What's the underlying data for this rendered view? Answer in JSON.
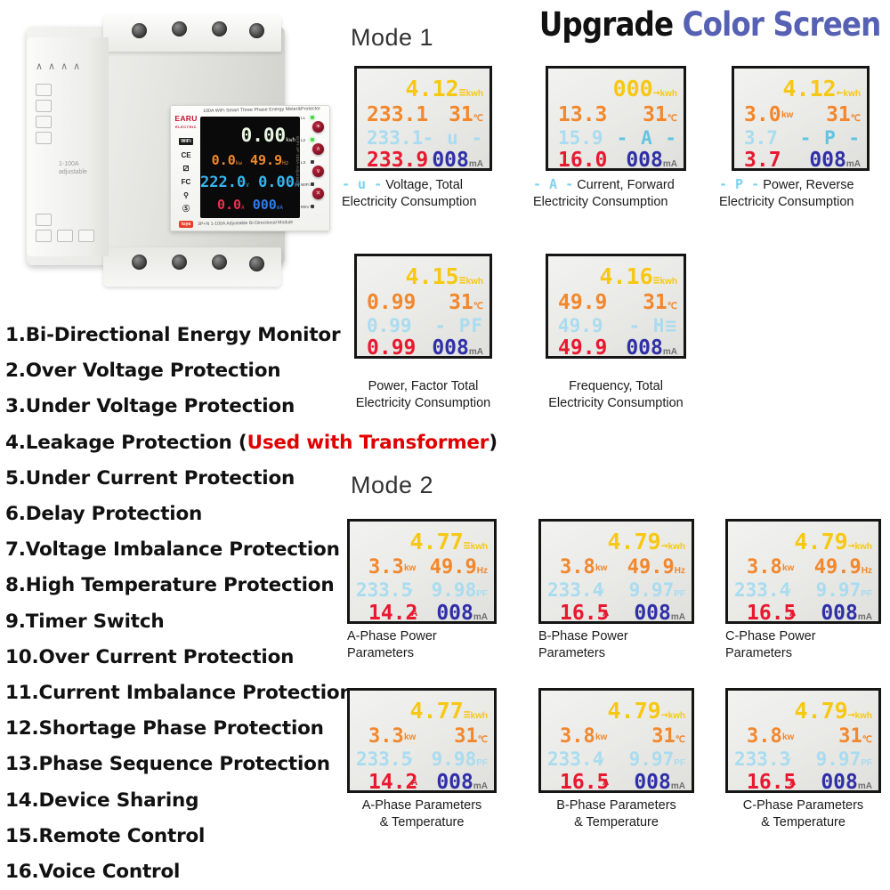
{
  "headline": {
    "part1": "Upgrade",
    "part2": "Color Screen"
  },
  "modes": {
    "mode1": "Mode 1",
    "mode2": "Mode 2"
  },
  "device": {
    "top_label": "100A WiFi Smart Three Phase Energy Meter&Protector",
    "bottom_label": "3P+N 1-100A Adjustable   Bi-Directional Module",
    "side_text": "1-100A adjustable",
    "vertical_text": "WIFI-3P-100A-Adjustable",
    "logo": "EARU",
    "logo_sub": "ELECTRIC",
    "badges": {
      "wifi": "WiFi",
      "ce": "CE",
      "rohs": "RoHS",
      "fc": "FC",
      "key": "Key",
      "power": "Power",
      "tuya": "tuya"
    },
    "lcd": {
      "energy": "0.00",
      "energy_unit": "kwh",
      "power": "0.0",
      "power_unit": "kw",
      "freq": "49.9",
      "freq_unit": "Hz",
      "voltage": "222.0",
      "voltage_unit": "V",
      "pf": "0.00",
      "pf_unit": "PF",
      "current": "0.0",
      "current_unit": "A",
      "leak": "000",
      "leak_unit": "mA"
    },
    "controls": [
      {
        "label": "L1",
        "led": "on",
        "button": "☀"
      },
      {
        "label": "L2",
        "led": "on",
        "button": "∧"
      },
      {
        "label": "L3",
        "led": "off",
        "button": "∨"
      },
      {
        "label": "WIFI",
        "led": "off",
        "button": "✕"
      },
      {
        "label": "REV",
        "led": "off",
        "button": ""
      }
    ]
  },
  "features": [
    {
      "text": "1.Bi-Directional Energy Monitor"
    },
    {
      "text": "2.Over Voltage Protection"
    },
    {
      "text": "3.Under Voltage Protection"
    },
    {
      "text": "4.Leakage Protection (",
      "note": "Used with Transformer",
      "tail": ")"
    },
    {
      "text": "5.Under Current Protection"
    },
    {
      "text": "6.Delay Protection"
    },
    {
      "text": "7.Voltage Imbalance Protection"
    },
    {
      "text": "8.High Temperature Protection"
    },
    {
      "text": "9.Timer Switch"
    },
    {
      "text": "10.Over Current Protection"
    },
    {
      "text": "11.Current Imbalance Protection"
    },
    {
      "text": "12.Shortage Phase Protection"
    },
    {
      "text": "13.Phase Sequence Protection"
    },
    {
      "text": "14.Device Sharing"
    },
    {
      "text": "15.Remote Control"
    },
    {
      "text": "16.Voice Control"
    }
  ],
  "mode1_panels": [
    {
      "id": "voltage-total",
      "l1_value": "4.12",
      "l1_mark": "≡",
      "l1_unit": "kwh",
      "l2_left": "233.1",
      "l2_left_unit": "",
      "l2_right": "31",
      "l2_right_unit": "℃",
      "l3_left": "233.1",
      "l3_left_unit": "v",
      "l3_sym": "- u -",
      "l4_left": "233.9",
      "l4_left_unit": "",
      "l4_right": "008",
      "l4_right_unit": "mA",
      "caption_sym": "- u -",
      "caption_l1": "Voltage, Total",
      "caption_l2": "Electricity Consumption"
    },
    {
      "id": "current-forward",
      "l1_value": "000",
      "l1_mark": "→",
      "l1_unit": "kwh",
      "l2_left": "13.3",
      "l2_left_unit": "",
      "l2_right": "31",
      "l2_right_unit": "℃",
      "l3_left": "15.9",
      "l3_left_unit": "v",
      "l3_sym": "- A -",
      "l4_left": "16.0",
      "l4_left_unit": "A",
      "l4_right": "008",
      "l4_right_unit": "mA",
      "caption_sym": "- A -",
      "caption_l1": "Current, Forward",
      "caption_l2": "Electricity Consumption"
    },
    {
      "id": "power-reverse",
      "l1_value": "4.12",
      "l1_mark": "←",
      "l1_unit": "kwh",
      "l2_left": "3.0",
      "l2_left_unit": "kw",
      "l2_right": "31",
      "l2_right_unit": "℃",
      "l3_left": "3.7",
      "l3_left_unit": "",
      "l3_sym": "- P -",
      "l4_left": "3.7",
      "l4_left_unit": "",
      "l4_right": "008",
      "l4_right_unit": "mA",
      "caption_sym": "- P -",
      "caption_l1": "Power, Reverse",
      "caption_l2": "Electricity Consumption"
    },
    {
      "id": "power-factor-total",
      "l1_value": "4.15",
      "l1_mark": "≡",
      "l1_unit": "kwh",
      "l2_left": "0.99",
      "l2_left_unit": "",
      "l2_right": "31",
      "l2_right_unit": "℃",
      "l3_left": "0.99",
      "l3_left_unit": "",
      "l3_sym": "- PF",
      "l4_left": "0.99",
      "l4_left_unit": "",
      "l4_right": "008",
      "l4_right_unit": "mA",
      "caption_sym": "",
      "caption_l1": "Power, Factor Total",
      "caption_l2": "Electricity Consumption"
    },
    {
      "id": "frequency-total",
      "l1_value": "4.16",
      "l1_mark": "≡",
      "l1_unit": "kwh",
      "l2_left": "49.9",
      "l2_left_unit": "",
      "l2_right": "31",
      "l2_right_unit": "℃",
      "l3_left": "49.9",
      "l3_left_unit": "",
      "l3_sym": "- H≡",
      "l4_left": "49.9",
      "l4_left_unit": "",
      "l4_right": "008",
      "l4_right_unit": "mA",
      "caption_sym": "",
      "caption_l1": "Frequency, Total",
      "caption_l2": "Electricity Consumption"
    }
  ],
  "mode2_panels": [
    {
      "id": "a-phase-power",
      "l1_value": "4.77",
      "l1_mark": "≡",
      "l1_unit": "kwh",
      "l2_left": "3.3",
      "l2_left_unit": "kw",
      "l2_right": "49.9",
      "l2_right_unit": "Hz",
      "l3_left": "233.5",
      "l3_left_unit": "v",
      "l3_right": "9.98",
      "l3_right_unit": "PF",
      "l4_left": "14.2",
      "l4_left_unit": "A",
      "l4_right": "008",
      "l4_right_unit": "mA",
      "caption_l1": "A-Phase Power Parameters",
      "caption_l2": ""
    },
    {
      "id": "b-phase-power",
      "l1_value": "4.79",
      "l1_mark": "→",
      "l1_unit": "kwh",
      "l2_left": "3.8",
      "l2_left_unit": "kw",
      "l2_right": "49.9",
      "l2_right_unit": "Hz",
      "l3_left": "233.4",
      "l3_left_unit": "v",
      "l3_right": "9.97",
      "l3_right_unit": "PF",
      "l4_left": "16.5",
      "l4_left_unit": "A",
      "l4_right": "008",
      "l4_right_unit": "mA",
      "caption_l1": "B-Phase Power Parameters",
      "caption_l2": ""
    },
    {
      "id": "c-phase-power",
      "l1_value": "4.79",
      "l1_mark": "→",
      "l1_unit": "kwh",
      "l2_left": "3.8",
      "l2_left_unit": "kw",
      "l2_right": "49.9",
      "l2_right_unit": "Hz",
      "l3_left": "233.4",
      "l3_left_unit": "v",
      "l3_right": "9.97",
      "l3_right_unit": "PF",
      "l4_left": "16.5",
      "l4_left_unit": "A",
      "l4_right": "008",
      "l4_right_unit": "mA",
      "caption_l1": "C-Phase Power Parameters",
      "caption_l2": ""
    },
    {
      "id": "a-phase-temp",
      "l1_value": "4.77",
      "l1_mark": "≡",
      "l1_unit": "kwh",
      "l2_left": "3.3",
      "l2_left_unit": "kw",
      "l2_right": "31",
      "l2_right_unit": "℃",
      "l3_left": "233.5",
      "l3_left_unit": "v",
      "l3_right": "9.98",
      "l3_right_unit": "PF",
      "l4_left": "14.2",
      "l4_left_unit": "A",
      "l4_right": "008",
      "l4_right_unit": "mA",
      "caption_l1": "A-Phase Parameters",
      "caption_l2": "& Temperature"
    },
    {
      "id": "b-phase-temp",
      "l1_value": "4.79",
      "l1_mark": "→",
      "l1_unit": "kwh",
      "l2_left": "3.8",
      "l2_left_unit": "kw",
      "l2_right": "31",
      "l2_right_unit": "℃",
      "l3_left": "233.4",
      "l3_left_unit": "v",
      "l3_right": "9.97",
      "l3_right_unit": "PF",
      "l4_left": "16.5",
      "l4_left_unit": "A",
      "l4_right": "008",
      "l4_right_unit": "mA",
      "caption_l1": "B-Phase Parameters",
      "caption_l2": "&  Temperature"
    },
    {
      "id": "c-phase-temp",
      "l1_value": "4.79",
      "l1_mark": "→",
      "l1_unit": "kwh",
      "l2_left": "3.8",
      "l2_left_unit": "kw",
      "l2_right": "31",
      "l2_right_unit": "℃",
      "l3_left": "233.3",
      "l3_left_unit": "v",
      "l3_right": "9.97",
      "l3_right_unit": "PF",
      "l4_left": "16.5",
      "l4_left_unit": "A",
      "l4_right": "008",
      "l4_right_unit": "mA",
      "caption_l1": "C-Phase Parameters",
      "caption_l2": "&  Temperature"
    }
  ],
  "colors": {
    "accent_blue": "#5661b3",
    "note_red": "#e00000",
    "lcd_yellow": "#f7c813",
    "lcd_orange": "#f2872c",
    "lcd_cyan": "#a9dcf0",
    "lcd_red": "#e8182f",
    "lcd_blue": "#2f2fa8"
  }
}
